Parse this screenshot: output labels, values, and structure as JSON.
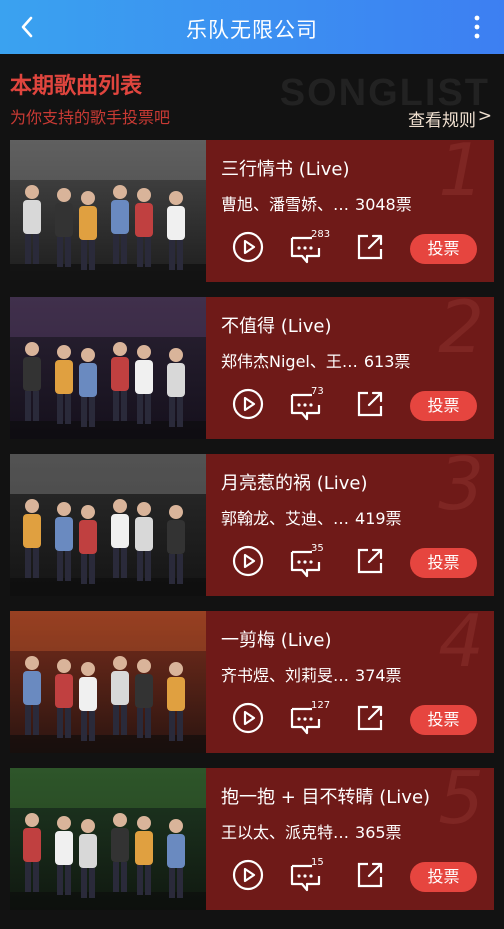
{
  "nav": {
    "title": "乐队无限公司"
  },
  "header": {
    "title": "本期歌曲列表",
    "subtitle": "为你支持的歌手投票吧",
    "bg_word": "SONGLIST",
    "rules_label": "查看规则",
    "rules_arrow": ">"
  },
  "songs": [
    {
      "rank": "1",
      "title": "三行情书 (Live)",
      "artists": "曹旭、潘雪娇、…",
      "votes": "3048票",
      "comments": "283",
      "vote_label": "投票"
    },
    {
      "rank": "2",
      "title": "不值得 (Live)",
      "artists": "郑伟杰Nigel、王…",
      "votes": "613票",
      "comments": "73",
      "vote_label": "投票"
    },
    {
      "rank": "3",
      "title": "月亮惹的祸 (Live)",
      "artists": "郭翰龙、艾迪、…",
      "votes": "419票",
      "comments": "35",
      "vote_label": "投票"
    },
    {
      "rank": "4",
      "title": "一剪梅 (Live)",
      "artists": "齐书煜、刘莉旻…",
      "votes": "374票",
      "comments": "127",
      "vote_label": "投票"
    },
    {
      "rank": "5",
      "title": "抱一抱 + 目不转睛 (Live)",
      "artists": "王以太、派克特…",
      "votes": "365票",
      "comments": "15",
      "vote_label": "投票"
    }
  ],
  "colors": {
    "nav": "#3d8ff2",
    "card": "#6f1a18",
    "accent": "#e6453f",
    "background": "#121212"
  },
  "icons": [
    "back-icon",
    "more-icon",
    "play-icon",
    "comment-icon",
    "share-icon"
  ]
}
